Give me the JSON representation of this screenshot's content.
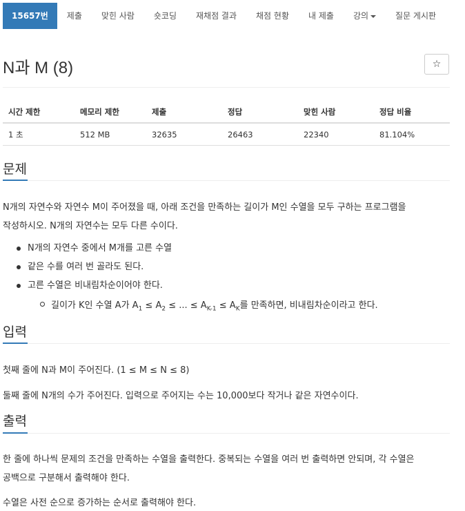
{
  "nav": {
    "problem_id": "15657번",
    "items": [
      "제출",
      "맞힌 사람",
      "숏코딩",
      "재채점 결과",
      "채점 현황",
      "내 제출"
    ],
    "lecture": "강의",
    "board": "질문 게시판"
  },
  "title": "N과 M (8)",
  "star_icon": "☆",
  "info": {
    "headers": [
      "시간 제한",
      "메모리 제한",
      "제출",
      "정답",
      "맞힌 사람",
      "정답 비율"
    ],
    "values": [
      "1 초",
      "512 MB",
      "32635",
      "26463",
      "22340",
      "81.104%"
    ]
  },
  "problem": {
    "heading": "문제",
    "line1": "N개의 자연수와 자연수 M이 주어졌을 때, 아래 조건을 만족하는 길이가 M인 수열을 모두 구하는 프로그램을",
    "line2": "작성하시오. N개의 자연수는 모두 다른 수이다.",
    "bullets": [
      "N개의 자연수 중에서 M개를 고른 수열",
      "같은 수를 여러 번 골라도 된다.",
      "고른 수열은 비내림차순이어야 한다."
    ],
    "sub_pre": "길이가 K인 수열 A가 A",
    "sub_1": "1",
    "sub_mid1": " ≤ A",
    "sub_2": "2",
    "sub_mid2": " ≤ ... ≤ A",
    "sub_k1": "K-1",
    "sub_mid3": " ≤ A",
    "sub_k": "K",
    "sub_post": "를 만족하면, 비내림차순이라고 한다."
  },
  "input": {
    "heading": "입력",
    "line1": "첫째 줄에 N과 M이 주어진다. (1 ≤ M ≤ N ≤ 8)",
    "line2": "둘째 줄에 N개의 수가 주어진다. 입력으로 주어지는 수는 10,000보다 작거나 같은 자연수이다."
  },
  "output": {
    "heading": "출력",
    "line1": "한 줄에 하나씩 문제의 조건을 만족하는 수열을 출력한다. 중복되는 수열을 여러 번 출력하면 안되며, 각 수열은",
    "line2": "공백으로 구분해서 출력해야 한다.",
    "line3": "수열은 사전 순으로 증가하는 순서로 출력해야 한다."
  }
}
